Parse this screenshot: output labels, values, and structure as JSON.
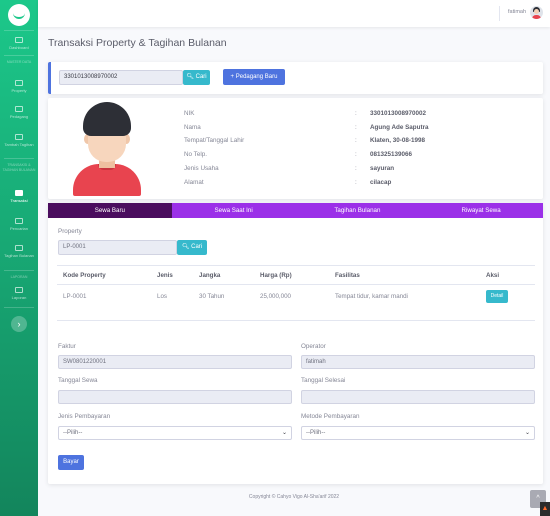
{
  "sidebar": {
    "items": [
      {
        "label": "Dashboard",
        "icon": "dashboard-icon"
      },
      {
        "label": "Property",
        "icon": "building-icon"
      },
      {
        "label": "Pedagang",
        "icon": "user-icon"
      },
      {
        "label": "Tambah Tagihan",
        "icon": "plus-file-icon"
      },
      {
        "label": "Transaksi",
        "icon": "cash-icon",
        "active": true
      },
      {
        "label": "Pencarian",
        "icon": "search-icon"
      },
      {
        "label": "Tagihan Bulanan",
        "icon": "calendar-icon"
      },
      {
        "label": "Laporan",
        "icon": "report-icon"
      }
    ],
    "headings": [
      "MASTER DATA",
      "TRANSAKSI & TAGIHAN BULANAN",
      "LAPORAN"
    ]
  },
  "topbar": {
    "username": "fatimah"
  },
  "page": {
    "title": "Transaksi Property & Tagihan Bulanan"
  },
  "search": {
    "nik_value": "3301013008970002",
    "cari_label": "Cari",
    "add_label": "Pedagang Baru"
  },
  "profile": {
    "rows": [
      {
        "label": "NIK",
        "value": "3301013008970002"
      },
      {
        "label": "Nama",
        "value": "Agung Ade Saputra"
      },
      {
        "label": "Tempat/Tanggal Lahir",
        "value": "Klaten, 30-08-1998"
      },
      {
        "label": "No Telp.",
        "value": "081325139066"
      },
      {
        "label": "Jenis Usaha",
        "value": "sayuran"
      },
      {
        "label": "Alamat",
        "value": "cilacap"
      }
    ]
  },
  "tabs": [
    "Sewa Baru",
    "Sewa Saat Ini",
    "Tagihan Bulanan",
    "Riwayat Sewa"
  ],
  "property_section": {
    "label": "Property",
    "value": "LP-0001",
    "cari_label": "Cari"
  },
  "table": {
    "headers": [
      "Kode Property",
      "Jenis",
      "Jangka",
      "Harga (Rp)",
      "Fasilitas",
      "Aksi"
    ],
    "rows": [
      {
        "kode": "LP-0001",
        "jenis": "Los",
        "jangka": "30 Tahun",
        "harga": "25,000,000",
        "fasilitas": "Tempat tidur, kamar mandi",
        "aksi": "Detail"
      }
    ]
  },
  "form": {
    "faktur_label": "Faktur",
    "faktur_value": "SW0801220001",
    "operator_label": "Operator",
    "operator_value": "fatimah",
    "tgl_sewa_label": "Tanggal Sewa",
    "tgl_selesai_label": "Tanggal Selesai",
    "jenis_pembayaran_label": "Jenis Pembayaran",
    "jenis_pembayaran_value": "--Pilih--",
    "metode_pembayaran_label": "Metode Pembayaran",
    "metode_pembayaran_value": "--Pilih--",
    "submit_label": "Bayar"
  },
  "footer": {
    "copyright": "Copyright © Cahyo Vigo Al-Sha'arif 2022"
  },
  "colors": {
    "sidebar": "#1cc88a",
    "tab_bar": "#9b30e8",
    "tab_active": "#4a0d5e",
    "primary": "#4e73df",
    "info": "#36b9cc"
  }
}
